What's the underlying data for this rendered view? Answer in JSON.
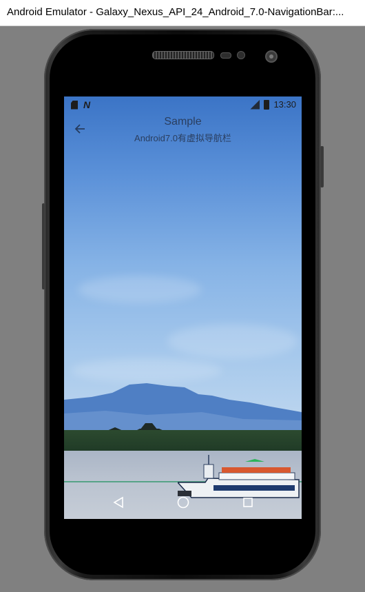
{
  "window": {
    "title": "Android Emulator - Galaxy_Nexus_API_24_Android_7.0-NavigationBar:..."
  },
  "status_bar": {
    "time": "13:30",
    "icons": [
      "sd-card-icon",
      "n-notification-icon",
      "signal-icon",
      "battery-icon"
    ],
    "n_glyph": "N"
  },
  "app_bar": {
    "title": "Sample",
    "subtitle": "Android7.0有虚拟导航栏",
    "back_icon": "arrow-left-icon"
  },
  "nav_bar": {
    "buttons": [
      "back-triangle-icon",
      "home-circle-icon",
      "recents-square-icon"
    ]
  },
  "colors": {
    "background": "#808080",
    "sky_top": "#3b74c6",
    "sky_bottom": "#c4d9ef",
    "text": "#2a3e5f"
  }
}
